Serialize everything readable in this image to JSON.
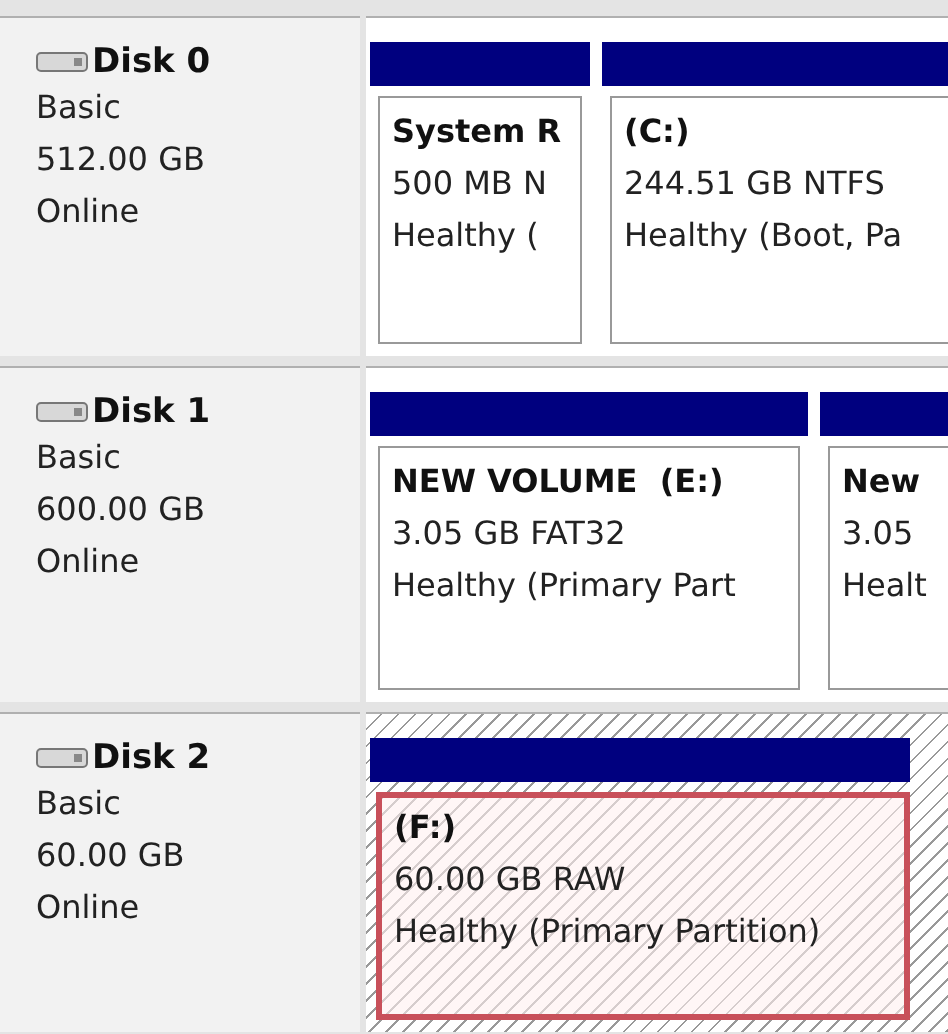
{
  "disks": [
    {
      "name": "Disk 0",
      "type": "Basic",
      "size": "512.00 GB",
      "status": "Online",
      "partitions": [
        {
          "label": "System R",
          "detail": "500 MB N",
          "status": "Healthy (",
          "selected": false
        },
        {
          "label": "(C:)",
          "detail": "244.51 GB NTFS",
          "status": "Healthy (Boot, Pa",
          "selected": false
        }
      ]
    },
    {
      "name": "Disk 1",
      "type": "Basic",
      "size": "600.00 GB",
      "status": "Online",
      "partitions": [
        {
          "label": "NEW VOLUME  (E:)",
          "detail": "3.05 GB FAT32",
          "status": "Healthy (Primary Part",
          "selected": false
        },
        {
          "label": "New",
          "detail": "3.05",
          "status": "Healt",
          "selected": false
        }
      ]
    },
    {
      "name": "Disk 2",
      "type": "Basic",
      "size": "60.00 GB",
      "status": "Online",
      "partitions": [
        {
          "label": "(F:)",
          "detail": "60.00 GB RAW",
          "status": "Healthy (Primary Partition)",
          "selected": true
        }
      ]
    }
  ]
}
